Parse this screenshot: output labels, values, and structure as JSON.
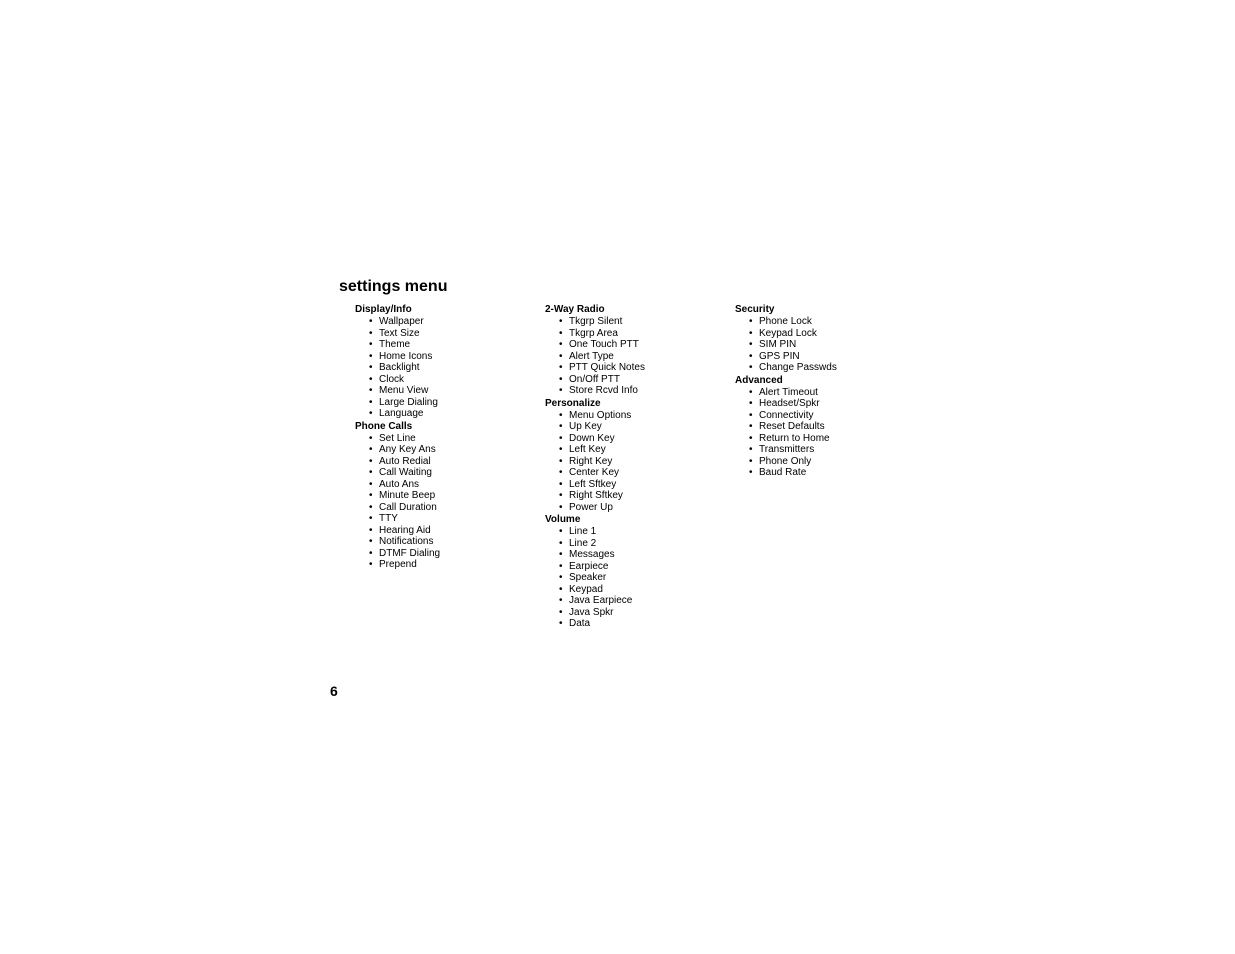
{
  "title": "settings menu",
  "pageNumber": "6",
  "columns": [
    {
      "sections": [
        {
          "header": "Display/Info",
          "items": [
            "Wallpaper",
            "Text Size",
            "Theme",
            "Home Icons",
            "Backlight",
            "Clock",
            "Menu View",
            "Large Dialing",
            "Language"
          ]
        },
        {
          "header": "Phone Calls",
          "items": [
            "Set Line",
            "Any Key Ans",
            "Auto Redial",
            "Call Waiting",
            "Auto Ans",
            "Minute Beep",
            "Call Duration",
            "TTY",
            "Hearing Aid",
            "Notifications",
            "DTMF Dialing",
            "Prepend"
          ]
        }
      ]
    },
    {
      "sections": [
        {
          "header": "2-Way Radio",
          "items": [
            "Tkgrp Silent",
            "Tkgrp Area",
            "One Touch PTT",
            "Alert Type",
            "PTT Quick Notes",
            "On/Off PTT",
            "Store Rcvd Info"
          ]
        },
        {
          "header": "Personalize",
          "items": [
            "Menu Options",
            "Up Key",
            "Down Key",
            "Left Key",
            "Right Key",
            "Center Key",
            "Left Sftkey",
            "Right Sftkey",
            "Power Up"
          ]
        },
        {
          "header": "Volume",
          "items": [
            "Line 1",
            "Line 2",
            "Messages",
            "Earpiece",
            "Speaker",
            "Keypad",
            "Java Earpiece",
            "Java Spkr",
            "Data"
          ]
        }
      ]
    },
    {
      "sections": [
        {
          "header": "Security",
          "items": [
            "Phone Lock",
            "Keypad Lock",
            "SIM PIN",
            "GPS PIN",
            "Change Passwds"
          ]
        },
        {
          "header": "Advanced",
          "items": [
            "Alert Timeout",
            "Headset/Spkr",
            "Connectivity",
            "Reset Defaults",
            "Return to Home",
            "Transmitters",
            "Phone Only",
            "Baud Rate"
          ]
        }
      ]
    }
  ]
}
